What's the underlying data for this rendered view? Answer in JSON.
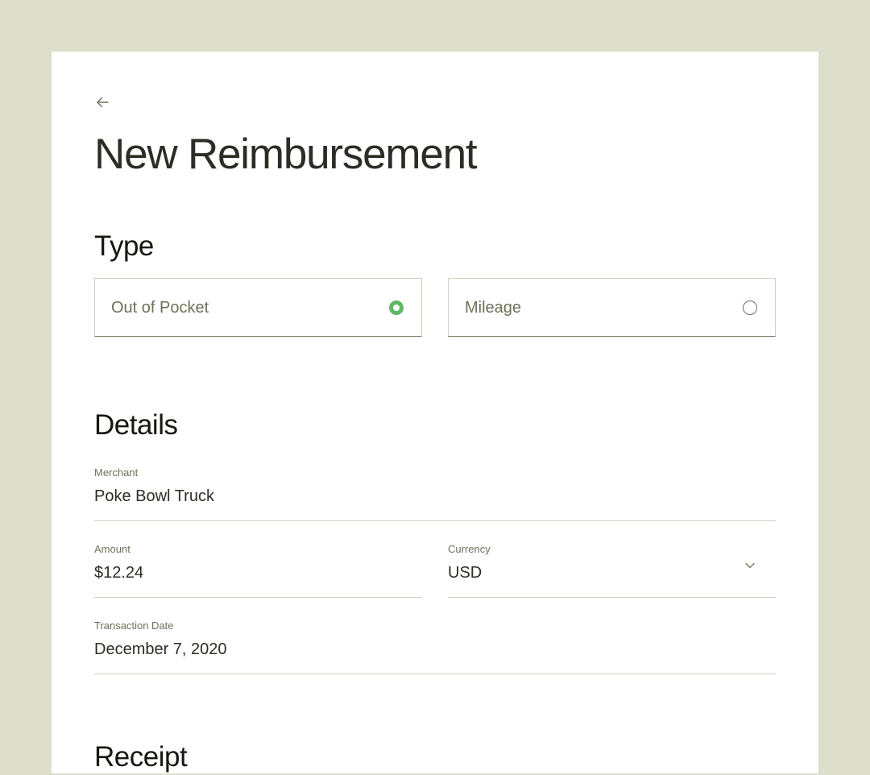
{
  "header": {
    "back_icon": "arrow-left-icon",
    "title": "New Reimbursement"
  },
  "type_section": {
    "title": "Type",
    "options": [
      {
        "label": "Out of Pocket",
        "selected": true,
        "icon": "radio-checked-icon"
      },
      {
        "label": "Mileage",
        "selected": false,
        "icon": "radio-unchecked-icon"
      }
    ]
  },
  "details_section": {
    "title": "Details",
    "merchant": {
      "label": "Merchant",
      "value": "Poke Bowl Truck"
    },
    "amount": {
      "label": "Amount",
      "value": "$12.24"
    },
    "currency": {
      "label": "Currency",
      "value": "USD",
      "icon": "chevron-down-icon"
    },
    "transaction_date": {
      "label": "Transaction Date",
      "value": "December 7, 2020"
    }
  },
  "receipt_section": {
    "title": "Receipt"
  },
  "colors": {
    "background": "#dddfcb",
    "card": "#ffffff",
    "accent_green": "#5fb865",
    "text_primary": "#2c2d26",
    "text_muted": "#6e7059",
    "border": "#cfd1bd"
  }
}
